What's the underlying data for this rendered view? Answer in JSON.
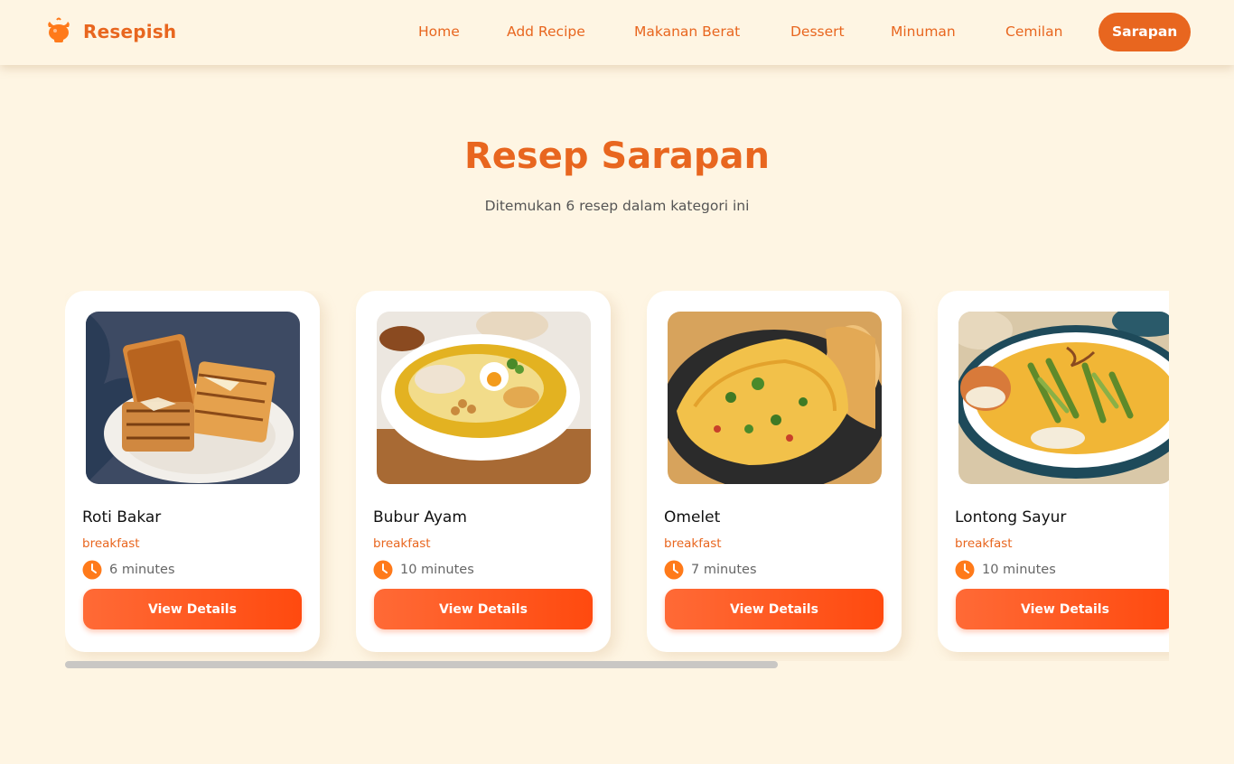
{
  "brand": {
    "name": "Resepish",
    "icon": "cooking-pot-icon",
    "accent": "#e8661f"
  },
  "nav": {
    "items": [
      {
        "label": "Home"
      },
      {
        "label": "Add Recipe"
      },
      {
        "label": "Makanan Berat"
      },
      {
        "label": "Dessert"
      },
      {
        "label": "Minuman"
      },
      {
        "label": "Cemilan"
      },
      {
        "label": "Sarapan",
        "active": true
      }
    ]
  },
  "hero": {
    "title": "Resep Sarapan",
    "subtitle": "Ditemukan 6 resep dalam kategori ini"
  },
  "recipes": [
    {
      "name": "Roti Bakar",
      "category": "breakfast",
      "time": "6 minutes",
      "button": "View Details",
      "image": "toast-photo"
    },
    {
      "name": "Bubur Ayam",
      "category": "breakfast",
      "time": "10 minutes",
      "button": "View Details",
      "image": "porridge-photo"
    },
    {
      "name": "Omelet",
      "category": "breakfast",
      "time": "7 minutes",
      "button": "View Details",
      "image": "omelet-photo"
    },
    {
      "name": "Lontong Sayur",
      "category": "breakfast",
      "time": "10 minutes",
      "button": "View Details",
      "image": "curry-photo"
    }
  ],
  "colors": {
    "background": "#fef5e3",
    "accent": "#e8661f",
    "button": "#ff5a1f"
  }
}
